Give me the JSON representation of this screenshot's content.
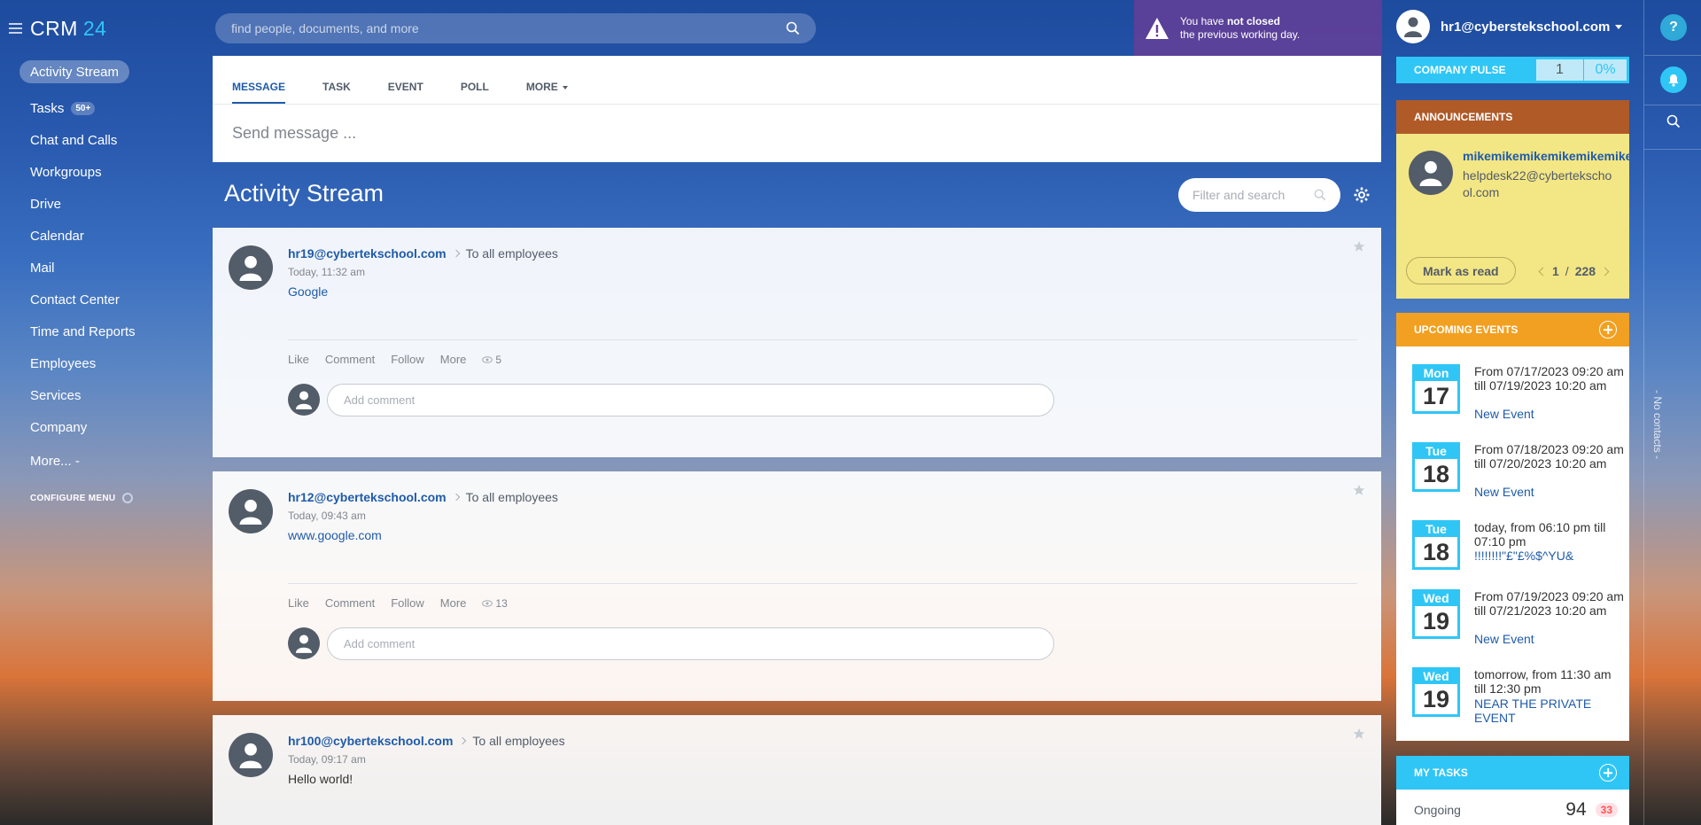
{
  "app": {
    "logo_main": "CRM",
    "logo_num": "24"
  },
  "sidebar": {
    "items": [
      {
        "label": "Activity Stream"
      },
      {
        "label": "Tasks",
        "badge": "50+"
      },
      {
        "label": "Chat and Calls"
      },
      {
        "label": "Workgroups"
      },
      {
        "label": "Drive"
      },
      {
        "label": "Calendar"
      },
      {
        "label": "Mail"
      },
      {
        "label": "Contact Center"
      },
      {
        "label": "Time and Reports"
      },
      {
        "label": "Employees"
      },
      {
        "label": "Services"
      },
      {
        "label": "Company"
      }
    ],
    "more_label": "More... -",
    "configure_label": "CONFIGURE MENU"
  },
  "header": {
    "search_placeholder": "find people, documents, and more",
    "warning_prefix": "You have ",
    "warning_bold": "not closed",
    "warning_line2": "the previous working day.",
    "user_email": "hr1@cyberstekschool.com"
  },
  "right_strip": {
    "help_label": "?",
    "no_contacts": "- No contacts -"
  },
  "composer": {
    "tabs": [
      "MESSAGE",
      "TASK",
      "EVENT",
      "POLL",
      "MORE"
    ],
    "placeholder": "Send message ..."
  },
  "stream": {
    "title": "Activity Stream",
    "filter_placeholder": "Filter and search"
  },
  "posts": [
    {
      "author": "hr19@cybertekschool.com",
      "destination": "To all employees",
      "time": "Today, 11:32 am",
      "body": "Google",
      "body_is_link": true,
      "actions": [
        "Like",
        "Comment",
        "Follow",
        "More"
      ],
      "views": "5",
      "comment_placeholder": "Add comment"
    },
    {
      "author": "hr12@cybertekschool.com",
      "destination": "To all employees",
      "time": "Today, 09:43 am",
      "body": "www.google.com",
      "body_is_link": true,
      "actions": [
        "Like",
        "Comment",
        "Follow",
        "More"
      ],
      "views": "13",
      "comment_placeholder": "Add comment"
    },
    {
      "author": "hr100@cybertekschool.com",
      "destination": "To all employees",
      "time": "Today, 09:17 am",
      "body": "Hello world!",
      "body_is_link": false
    }
  ],
  "pulse": {
    "label": "COMPANY PULSE",
    "value": "1",
    "percent": "0%"
  },
  "announcements": {
    "title": "ANNOUNCEMENTS",
    "author": "mikemikemikemikemikemike",
    "email": "helpdesk22@cybertekschool.com",
    "mark_read": "Mark as read",
    "page_current": "1",
    "page_sep": "/",
    "page_total": "228"
  },
  "events": {
    "title": "UPCOMING EVENTS",
    "items": [
      {
        "dow": "Mon",
        "day": "17",
        "time": "From 07/17/2023 09:20 am till 07/19/2023 10:20 am",
        "name": "New Event"
      },
      {
        "dow": "Tue",
        "day": "18",
        "time": "From 07/18/2023 09:20 am till 07/20/2023 10:20 am",
        "name": "New Event"
      },
      {
        "dow": "Tue",
        "day": "18",
        "time": "today, from 06:10 pm till 07:10 pm",
        "name": "!!!!!!!!\"£\"£%$^YU&"
      },
      {
        "dow": "Wed",
        "day": "19",
        "time": "From 07/19/2023 09:20 am till 07/21/2023 10:20 am",
        "name": "New Event"
      },
      {
        "dow": "Wed",
        "day": "19",
        "time": "tomorrow, from 11:30 am till 12:30 pm",
        "name": "NEAR THE PRIVATE EVENT"
      }
    ]
  },
  "tasks": {
    "title": "MY TASKS",
    "row_label": "Ongoing",
    "row_count": "94",
    "row_overdue": "33"
  },
  "colors": {
    "accent_blue": "#2fc6f6",
    "link_blue": "#1f5ba9",
    "announcement_header": "#b05a28",
    "announcement_body": "#f3e684",
    "events_header": "#f2a021",
    "warning_bg": "#6e3c96"
  }
}
